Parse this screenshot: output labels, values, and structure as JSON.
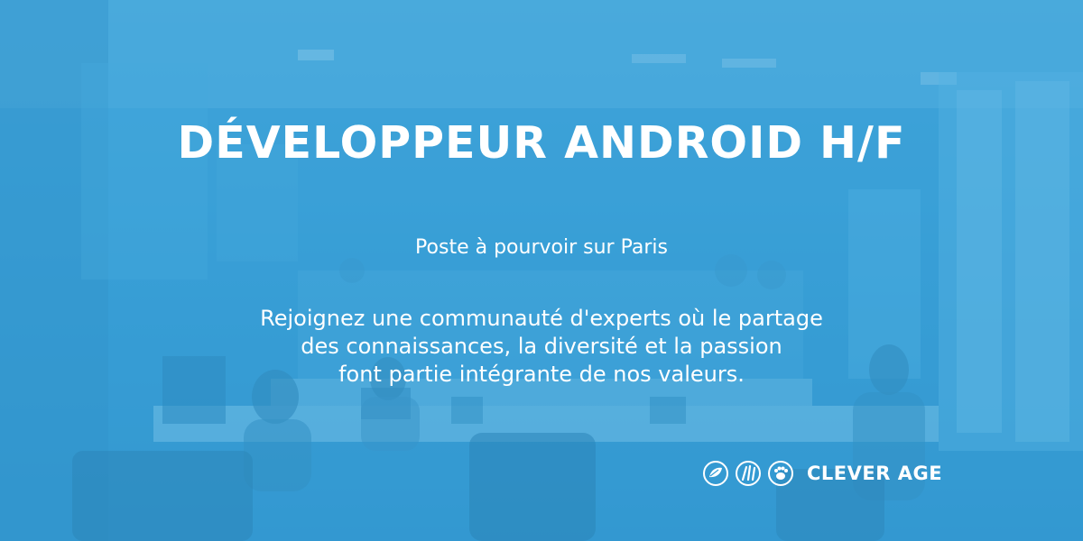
{
  "banner": {
    "title": "DÉVELOPPEUR ANDROID H/F",
    "location": "Poste à pourvoir sur Paris",
    "pitch_lines": [
      "Rejoignez une communauté d'experts où le partage",
      "des connaissances, la diversité et la passion",
      "font partie intégrante de nos valeurs."
    ]
  },
  "logo": {
    "text": "CLEVER AGE",
    "icons": [
      "leaf-circle-icon",
      "wheat-circle-icon",
      "paw-circle-icon"
    ]
  },
  "colors": {
    "overlay": "#36a0d8",
    "text": "#ffffff"
  }
}
